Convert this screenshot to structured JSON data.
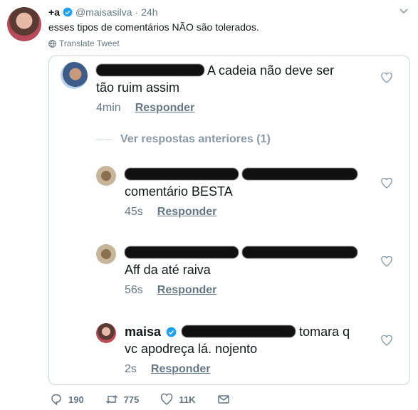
{
  "tweet": {
    "display_name": "+a",
    "handle": "@maisasilva",
    "dot": "·",
    "time": "24h",
    "text": "esses tipos de comentários NÃO são tolerados.",
    "translate_label": "Translate Tweet"
  },
  "comments": [
    {
      "after_censor": "A cadeia não deve ser",
      "line2": "tão ruim assim",
      "time": "4min",
      "reply": "Responder"
    },
    {
      "line2": "comentário BESTA",
      "time": "45s",
      "reply": "Responder"
    },
    {
      "line2": "Aff da até raiva",
      "time": "56s",
      "reply": "Responder"
    },
    {
      "name": "maisa",
      "after_censor": "tomara q",
      "line2": "vc apodreça lá. nojento",
      "time": "2s",
      "reply": "Responder"
    }
  ],
  "earlier_replies": "Ver respostas anteriores (1)",
  "actions": {
    "replies": "190",
    "retweets": "775",
    "likes": "11K"
  },
  "colors": {
    "verified": "#1da1f2",
    "muted": "#657786",
    "border": "#ccd6dd"
  },
  "icons": [
    "verified-icon",
    "globe-icon",
    "heart-icon",
    "reply-icon",
    "retweet-icon",
    "like-icon",
    "message-icon",
    "caret-icon"
  ]
}
